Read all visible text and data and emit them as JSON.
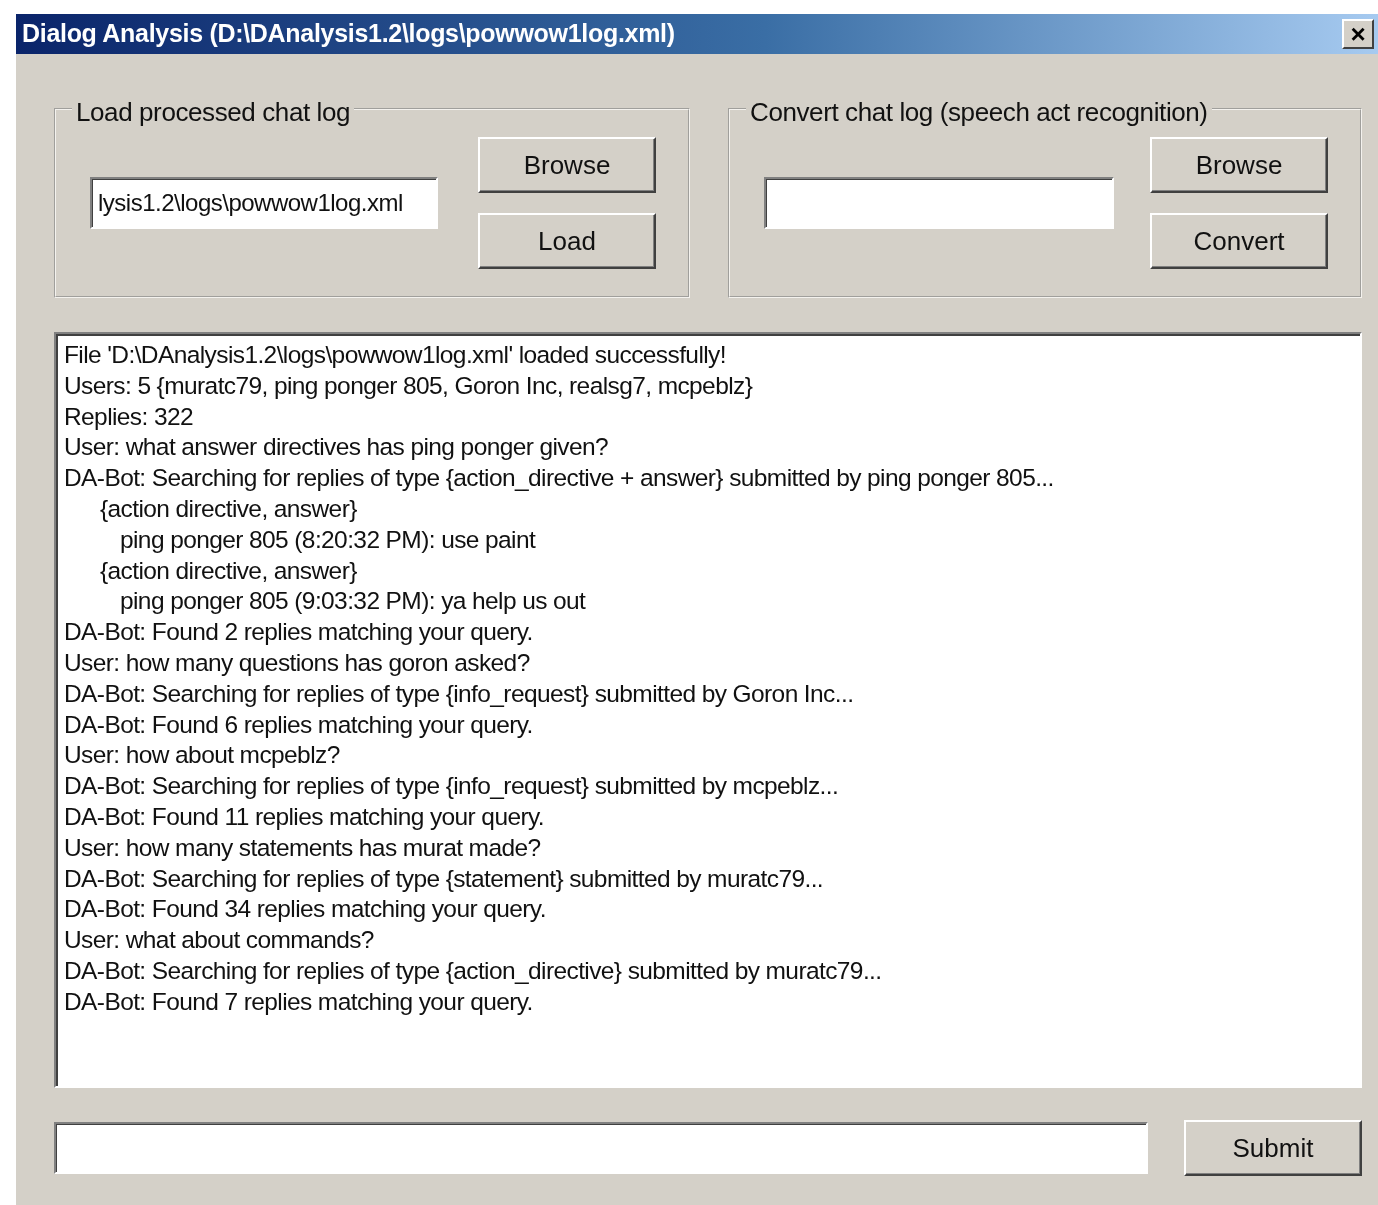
{
  "window": {
    "title": "Dialog Analysis (D:\\DAnalysis1.2\\logs\\powwow1log.xml)",
    "close": "×"
  },
  "load_group": {
    "label": "Load processed chat log",
    "path_value": "lysis1.2\\logs\\powwow1log.xml",
    "buttons": [
      "Browse",
      "Load"
    ]
  },
  "convert_group": {
    "label": "Convert chat log (speech act recognition)",
    "buttons": [
      "Browse",
      "Convert"
    ]
  },
  "log": [
    {
      "text": "File 'D:\\DAnalysis1.2\\logs\\powwow1log.xml' loaded successfully!"
    },
    {
      "text": "Users: 5 {muratc79, ping ponger 805, Goron Inc, realsg7, mcpeblz}"
    },
    {
      "text": "Replies: 322"
    },
    {
      "text": "User: what answer directives has ping ponger given?"
    },
    {
      "text": "DA-Bot: Searching for replies of type {action_directive + answer} submitted by ping ponger 805...",
      "children": [
        {
          "text": "{action directive, answer}",
          "children": [
            {
              "text": "ping ponger 805 (8:20:32 PM): use paint"
            }
          ]
        },
        {
          "text": "{action directive, answer}",
          "children": [
            {
              "text": "ping ponger 805 (9:03:32 PM): ya help us out"
            }
          ]
        }
      ]
    },
    {
      "text": "DA-Bot: Found 2 replies matching your query."
    },
    {
      "text": "User: how many questions has goron asked?"
    },
    {
      "text": "DA-Bot: Searching for replies of type {info_request} submitted by Goron Inc..."
    },
    {
      "text": "DA-Bot: Found 6 replies matching your query."
    },
    {
      "text": "User: how about mcpeblz?"
    },
    {
      "text": "DA-Bot: Searching for replies of type {info_request} submitted by mcpeblz..."
    },
    {
      "text": "DA-Bot: Found 11 replies matching your query."
    },
    {
      "text": "User: how many statements has murat made?"
    },
    {
      "text": "DA-Bot: Searching for replies of type {statement} submitted by muratc79..."
    },
    {
      "text": "DA-Bot: Found 34 replies matching your query."
    },
    {
      "text": "User: what about commands?"
    },
    {
      "text": "DA-Bot: Searching for replies of type {action_directive} submitted by muratc79..."
    },
    {
      "text": "DA-Bot: Found 7 replies matching your query."
    }
  ],
  "query": {
    "button": "Submit"
  }
}
